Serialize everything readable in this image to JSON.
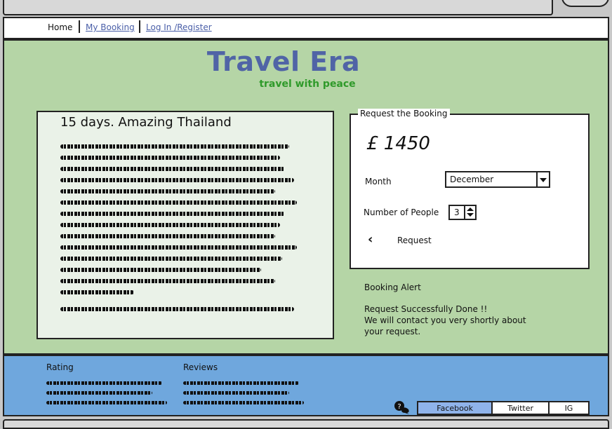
{
  "nav": {
    "home": "Home",
    "my_booking": "My Booking",
    "login": "Log In /Register"
  },
  "brand": {
    "title": "Travel Era",
    "tagline": "travel with peace"
  },
  "tour": {
    "title": "15 days. Amazing Thailand"
  },
  "booking": {
    "legend": "Request the Booking",
    "price": "£ 1450",
    "month_label": "Month",
    "month_value": "December",
    "people_label": "Number of People",
    "people_value": "3",
    "request_label": "Request"
  },
  "alert": {
    "title": "Booking Alert",
    "line1": "Request Successfully Done !!",
    "line2": "We will contact you very shortly about",
    "line3": "your request."
  },
  "footer": {
    "rating_label": "Rating",
    "reviews_label": "Reviews",
    "social": [
      "Facebook",
      "Twitter",
      "IG"
    ]
  },
  "colors": {
    "brand": "#5064a6",
    "tagline": "#2f9a2a",
    "main_bg": "#b5d5a6",
    "footer_bg": "#6fa7dd",
    "link": "#4a5fa8"
  }
}
